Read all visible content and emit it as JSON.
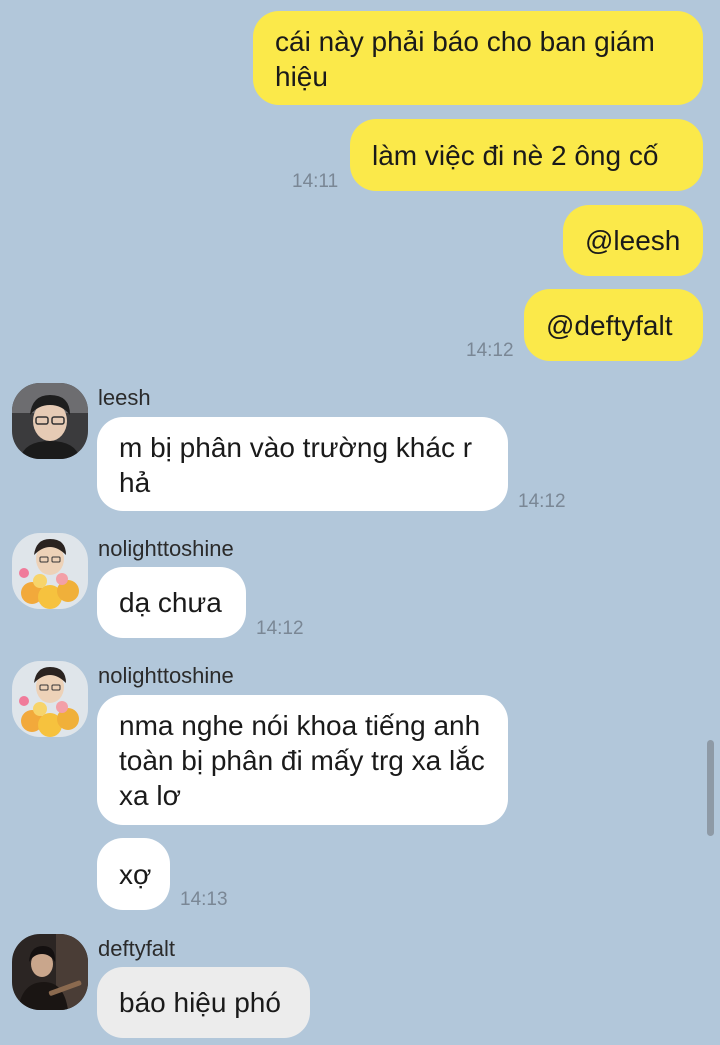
{
  "messages_out": [
    {
      "text": "cái này phải báo cho ban giám hiệu"
    },
    {
      "text": "làm việc đi nè 2 ông cố",
      "time": "14:11"
    },
    {
      "text": "@leesh"
    },
    {
      "text": "@deftyfalt",
      "time": "14:12"
    }
  ],
  "messages_in": [
    {
      "sender": "leesh",
      "text": "m bị phân vào trường khác r hả",
      "time": "14:12"
    },
    {
      "sender": "nolighttoshine",
      "text": "dạ chưa",
      "time": "14:12"
    },
    {
      "sender": "nolighttoshine",
      "text": "nma nghe nói khoa tiếng anh toàn bị phân đi mấy trg xa lắc xa lơ"
    },
    {
      "text": "xợ",
      "time": "14:13"
    },
    {
      "sender": "deftyfalt",
      "text": "báo hiệu phó"
    }
  ],
  "colors": {
    "background": "#b2c7da",
    "outgoing_bubble": "#fbe94a",
    "incoming_bubble": "#ffffff",
    "selected_bubble": "#ececec"
  }
}
